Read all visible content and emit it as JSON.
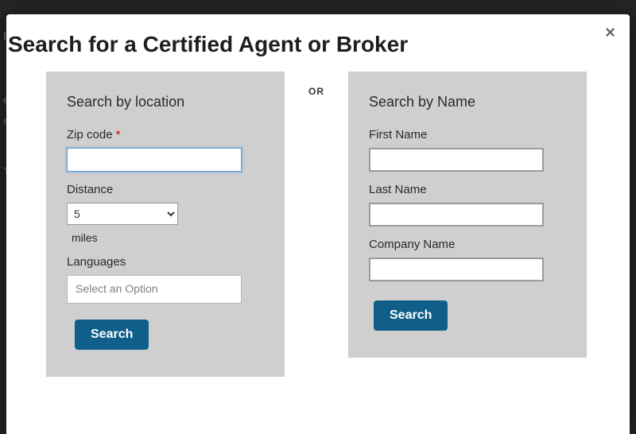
{
  "background": {
    "hint1": "E",
    "hint2": "ec",
    "hint3": "st",
    "hint4": "T"
  },
  "modal": {
    "title": "Search for a Certified Agent or Broker",
    "close": "×",
    "or": "OR",
    "left": {
      "heading": "Search by location",
      "zip_label": "Zip code",
      "zip_value": "",
      "required_mark": "*",
      "distance_label": "Distance",
      "distance_value": "5",
      "distance_unit": "miles",
      "languages_label": "Languages",
      "languages_placeholder": "Select an Option",
      "search_label": "Search"
    },
    "right": {
      "heading": "Search by Name",
      "first_name_label": "First Name",
      "first_name_value": "",
      "last_name_label": "Last Name",
      "last_name_value": "",
      "company_label": "Company Name",
      "company_value": "",
      "search_label": "Search"
    }
  }
}
